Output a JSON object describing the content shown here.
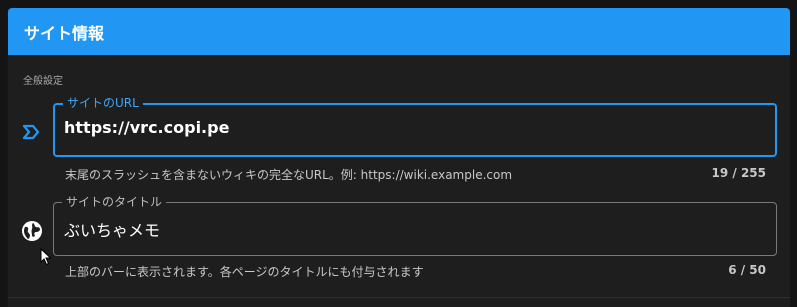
{
  "header": {
    "title": "サイト情報"
  },
  "section": {
    "label": "全般設定"
  },
  "fields": {
    "url": {
      "label": "サイトのURL",
      "value": "https://vrc.copi.pe",
      "hint": "末尾のスラッシュを含まないウィキの完全なURL。例: https://wiki.example.com",
      "counter": "19 / 255",
      "icon": "chevron-right-icon"
    },
    "title": {
      "label": "サイトのタイトル",
      "value": "ぶいちゃメモ",
      "hint": "上部のバーに表示されます。各ページのタイトルにも付与されます",
      "counter": "6 / 50",
      "icon": "globe-icon"
    }
  },
  "colors": {
    "accent": "#2196f3",
    "background": "#1e1e1e",
    "header_text": "#ffffff"
  }
}
